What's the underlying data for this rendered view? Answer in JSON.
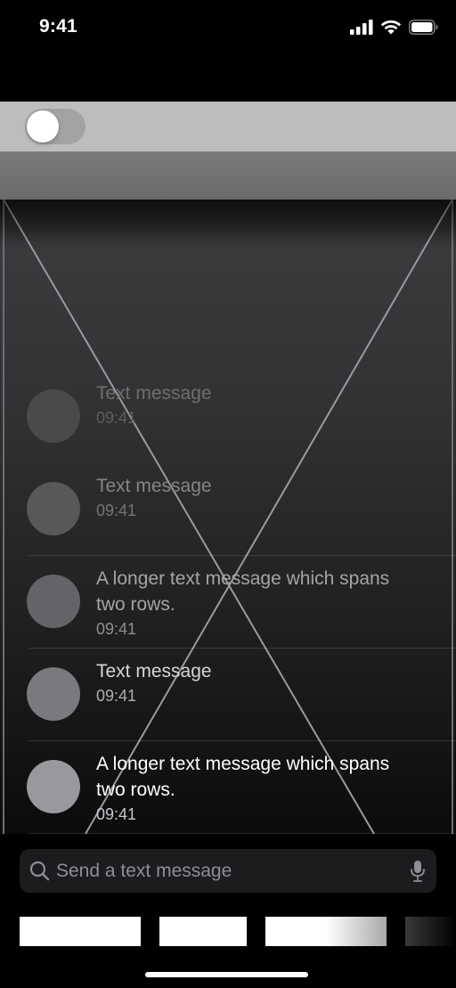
{
  "status_bar": {
    "time": "9:41",
    "icons": [
      "signal-bars-icon",
      "wifi-icon",
      "battery-icon"
    ]
  },
  "toggle": {
    "state": "off"
  },
  "messages": [
    {
      "text": "Text message",
      "time": "09:41",
      "avatar_color": "#4a4a4c",
      "text_color": "#6e6e70",
      "time_color": "#5d5d5f"
    },
    {
      "text": "Text message",
      "time": "09:41",
      "avatar_color": "#58585a",
      "text_color": "#858587",
      "time_color": "#76767a"
    },
    {
      "text": "A longer text message which spans two rows.",
      "time": "09:41",
      "avatar_color": "#646468",
      "text_color": "#a4a4a7",
      "time_color": "#8e8e93"
    },
    {
      "text": "Text message",
      "time": "09:41",
      "avatar_color": "#7a7a7e",
      "text_color": "#d6d6d8",
      "time_color": "#aeaeb2"
    },
    {
      "text": "A longer text message which spans two rows.",
      "time": "09:41",
      "avatar_color": "#98989d",
      "text_color": "#ffffff",
      "time_color": "#c7c7cc"
    }
  ],
  "composer": {
    "placeholder": "Send a text message",
    "leading_icon": "search-icon",
    "trailing_icon": "microphone-icon"
  },
  "colors": {
    "background": "#000000",
    "toggle_band": "#bdbdbd",
    "toggle_track": "#a3a3a6",
    "grey_band": "#707070",
    "input_background": "#1c1c1e",
    "placeholder_text": "#8e8e93"
  }
}
